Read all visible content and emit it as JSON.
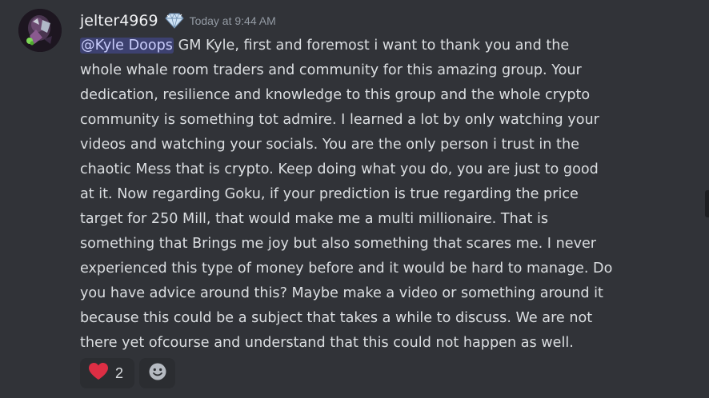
{
  "message": {
    "author": {
      "username": "jelter4969",
      "badge_icon": "diamond-badge-icon",
      "avatar_icon": "avatar"
    },
    "timestamp": "Today at 9:44 AM",
    "mention": "@Kyle Doops",
    "lines": [
      " GM Kyle, first and foremost i want to thank you and the",
      "whole whale room traders and community for this amazing group. Your",
      "dedication, resilience and knowledge to this group and the whole crypto",
      "community is something tot admire. I learned a lot by only watching your",
      "videos and watching your socials. You are the only person i trust in the",
      "chaotic Mess that is crypto. Keep doing what you do, you are just to good",
      "at it. Now regarding Goku, if your prediction is true regarding the price",
      "target for 250 Mill, that would make me a multi millionaire. That is",
      "something that Brings me joy but also something that scares me. I never",
      "experienced this type of money before and it would be hard to manage. Do",
      "you have advice around this? Maybe make a video or something around it",
      "because this could be a subject that takes a while to discuss. We are not",
      "there yet ofcourse and understand that this could not happen as well."
    ],
    "reactions": [
      {
        "icon": "red-heart-icon",
        "count": "2"
      },
      {
        "icon": "add-reaction-smiley-icon"
      }
    ]
  },
  "colors": {
    "background": "#313338",
    "text": "#dbdee1",
    "username": "#f2f3f5",
    "timestamp": "#949ba4",
    "mention_bg": "#3c4270",
    "mention_text": "#c9cdfb",
    "reaction_bg": "#2b2d31",
    "heart": "#dd2e44"
  }
}
